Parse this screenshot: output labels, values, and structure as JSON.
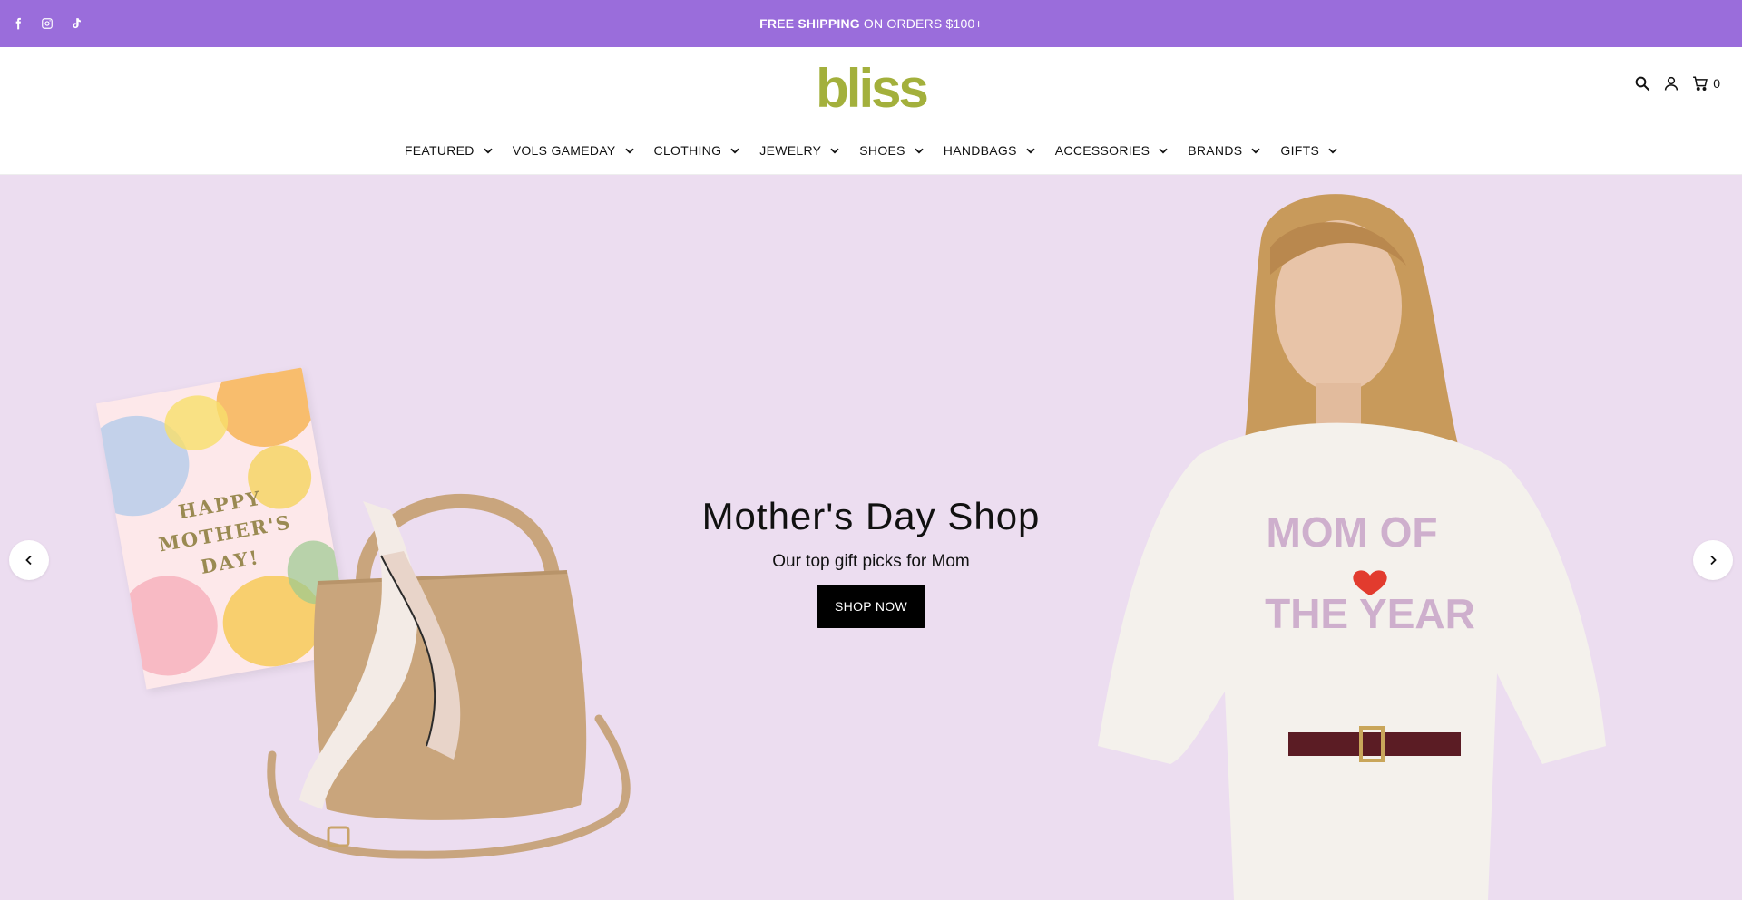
{
  "announcement": {
    "bold": "FREE SHIPPING",
    "rest": "ON ORDERS $100+",
    "social_icons": [
      "facebook-icon",
      "instagram-icon",
      "tiktok-icon"
    ]
  },
  "header": {
    "logo": "bliss",
    "cart_count": "0",
    "icons": [
      "search-icon",
      "account-icon",
      "cart-icon"
    ]
  },
  "nav": {
    "items": [
      {
        "label": "FEATURED"
      },
      {
        "label": "VOLS GAMEDAY"
      },
      {
        "label": "CLOTHING"
      },
      {
        "label": "JEWELRY"
      },
      {
        "label": "SHOES"
      },
      {
        "label": "HANDBAGS"
      },
      {
        "label": "ACCESSORIES"
      },
      {
        "label": "BRANDS"
      },
      {
        "label": "GIFTS"
      }
    ]
  },
  "hero": {
    "title": "Mother's Day Shop",
    "subtitle": "Our top gift picks for Mom",
    "cta": "SHOP NOW",
    "card_lines": [
      "HAPPY",
      "MOTHER'S",
      "DAY!"
    ],
    "shirt_lines": [
      "MOM OF",
      "THE YEAR"
    ]
  },
  "colors": {
    "announcement_bg": "#9a6ddb",
    "logo": "#a3b03c",
    "hero_bg": "#ecddf0",
    "cta_bg": "#000000"
  }
}
